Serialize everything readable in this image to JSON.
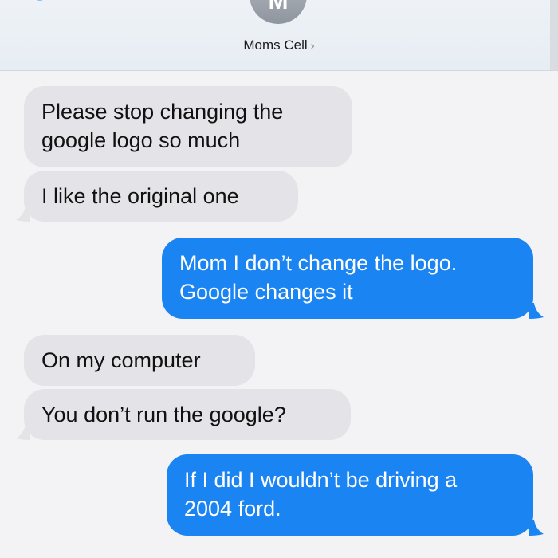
{
  "header": {
    "avatar_initial": "M",
    "contact_name": "Moms Cell",
    "chevron": "›"
  },
  "messages": [
    {
      "direction": "received",
      "text": "Please stop changing the\ngoogle logo so much"
    },
    {
      "direction": "received",
      "text": "I like the original one"
    },
    {
      "direction": "sent",
      "text": "Mom I don’t change the logo.\nGoogle changes it"
    },
    {
      "direction": "received",
      "text": "On my computer"
    },
    {
      "direction": "received",
      "text": "You don’t run the google?"
    },
    {
      "direction": "sent",
      "text": "If I did I wouldn’t be driving a\n2004 ford."
    }
  ],
  "colors": {
    "sent_bubble": "#1b84f3",
    "received_bubble": "#e3e3e8",
    "background": "#f3f3f5"
  }
}
